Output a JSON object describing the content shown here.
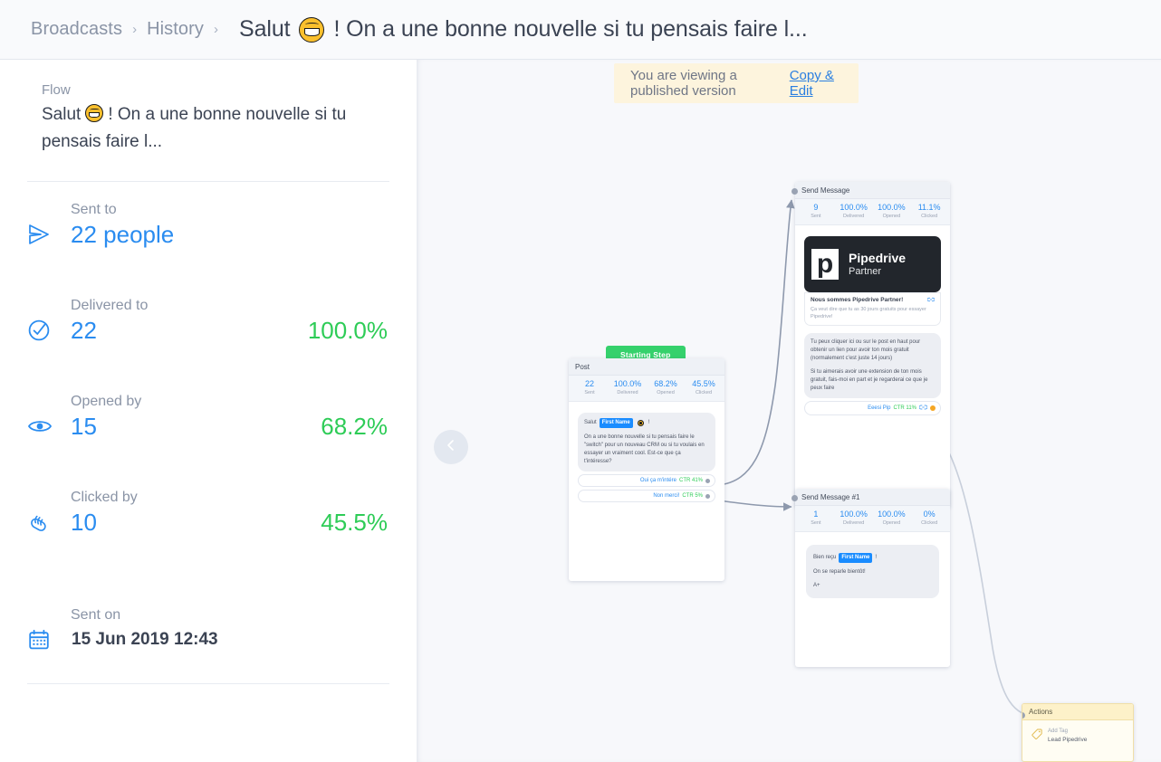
{
  "header": {
    "breadcrumbs": [
      {
        "label": "Broadcasts"
      },
      {
        "label": "History"
      }
    ],
    "separator": "›",
    "title_before_emoji": "Salut",
    "title_after_emoji": "! On a une bonne nouvelle si tu pensais faire l..."
  },
  "sidebar": {
    "flow_label": "Flow",
    "flow_name_before_emoji": "Salut",
    "flow_name_after_emoji": "! On a une bonne nouvelle si tu pensais faire l...",
    "stats": [
      {
        "label": "Sent to",
        "value": "22 people",
        "percent": "",
        "icon": "send-plane-icon"
      },
      {
        "label": "Delivered to",
        "value": "22",
        "percent": "100.0%",
        "icon": "check-circle-icon"
      },
      {
        "label": "Opened by",
        "value": "15",
        "percent": "68.2%",
        "icon": "eye-icon"
      },
      {
        "label": "Clicked by",
        "value": "10",
        "percent": "45.5%",
        "icon": "pointing-hand-icon"
      }
    ],
    "sent_on": {
      "label": "Sent on",
      "value": "15 Jun 2019 12:43",
      "icon": "calendar-icon"
    }
  },
  "canvas": {
    "banner": {
      "message": "You are viewing a published version",
      "action_label": "Copy & Edit"
    },
    "collapse_icon": "chevron-left-icon",
    "starting_step_label": "Starting Step",
    "nodes": [
      {
        "id": "post-node",
        "title": "Post",
        "stats": [
          {
            "value": "22",
            "label": "Sent"
          },
          {
            "value": "100.0%",
            "label": "Delivered"
          },
          {
            "value": "68.2%",
            "label": "Opened"
          },
          {
            "value": "45.5%",
            "label": "Clicked"
          }
        ],
        "message_prefix": "Salut",
        "message_token": "First Name",
        "message_body": "On a une bonne nouvelle si tu pensais faire le \"switch\" pour un nouveau CRM ou si tu voulais en essayer un vraiment cool. Est-ce que ça t'intéresse?",
        "quick_replies": [
          {
            "label": "Oui ça m'intére",
            "ctr": "CTR 41%"
          },
          {
            "label": "Non merci!",
            "ctr": "CTR 5%"
          }
        ]
      },
      {
        "id": "send-message-node",
        "title": "Send Message",
        "stats": [
          {
            "value": "9",
            "label": "Sent"
          },
          {
            "value": "100.0%",
            "label": "Delivered"
          },
          {
            "value": "100.0%",
            "label": "Opened"
          },
          {
            "value": "11.1%",
            "label": "Clicked"
          }
        ],
        "card": {
          "brand": "Pipedrive",
          "subtitle": "Partner",
          "mark": "p",
          "meta_title": "Nous sommes Pipedrive Partner!",
          "meta_desc": "Ça veut dire que tu as 30 jours gratuits pour essayer Pipedrive!",
          "meta_icon": "link-icon"
        },
        "bubble_paragraphs": [
          "Tu peux cliquer ici ou sur le post en haut pour obtenir un lien pour avoir ton mois gratuit (normalement c'est juste 14 jours)",
          "Si tu aimerais avoir une extension de ton mois gratuit, fais-moi en part et je regarderai ce que je peux faire"
        ],
        "quick_replies": [
          {
            "label": "Eeesi Pip",
            "ctr": "CTR 11%",
            "icon": "link-icon",
            "badge": "warning-icon"
          }
        ]
      },
      {
        "id": "send-message-1-node",
        "title": "Send Message #1",
        "stats": [
          {
            "value": "1",
            "label": "Sent"
          },
          {
            "value": "100.0%",
            "label": "Delivered"
          },
          {
            "value": "100.0%",
            "label": "Opened"
          },
          {
            "value": "0%",
            "label": "Clicked"
          }
        ],
        "message_prefix": "Bien reçu",
        "message_token": "First Name",
        "message_suffix": "!",
        "message_lines": [
          "On se reparle bientôt!",
          "A+"
        ]
      }
    ],
    "actions_node": {
      "title": "Actions",
      "icon": "tag-icon",
      "action_label": "Add Tag",
      "action_value": "Lead Pipedrive"
    }
  },
  "colors": {
    "accent_blue": "#2a8cf0",
    "success_green": "#2ecc57",
    "starting_step_green": "#35d16c",
    "banner_bg": "#fdf4dd",
    "canvas_bg": "#f7f8fb",
    "header_bg": "#f9fafc",
    "muted_text": "#8a94a6",
    "dark_text": "#3b4353"
  }
}
